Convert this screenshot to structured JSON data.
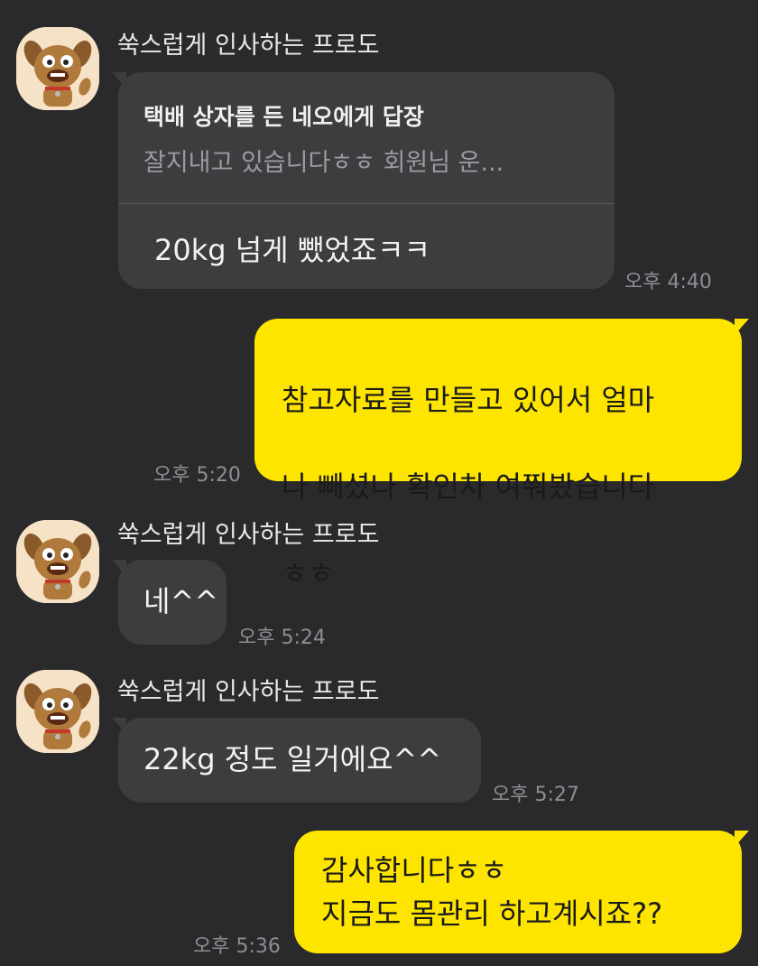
{
  "colors": {
    "background": "#2a2a2c",
    "bubble_received": "#3d3d40",
    "bubble_sent": "#fee500",
    "timestamp": "#8e8e92"
  },
  "avatar_icon": "dog-avatar-icon",
  "sender": {
    "name": "쑥스럽게 인사하는 프로도"
  },
  "messages": [
    {
      "direction": "received",
      "reply_to": {
        "title": "택배 상자를 든 네오에게 답장",
        "preview": "잘지내고 있습니다ㅎㅎ  회원님 운..."
      },
      "text": "20kg 넘게 뺐었죠ㅋㅋ",
      "time": "오후 4:40"
    },
    {
      "direction": "sent",
      "lines": [
        "참고자료를 만들고 있어서 얼마",
        "나 빼셨나 확인차 여쭤봤습니다",
        "ㅎㅎ"
      ],
      "time": "오후 5:20"
    },
    {
      "direction": "received",
      "text": "네^^",
      "time": "오후 5:24"
    },
    {
      "direction": "received",
      "text": "22kg 정도 일거에요^^",
      "time": "오후 5:27"
    },
    {
      "direction": "sent",
      "lines": [
        "감사합니다ㅎㅎ",
        "지금도 몸관리 하고계시죠??"
      ],
      "time": "오후 5:36"
    }
  ]
}
